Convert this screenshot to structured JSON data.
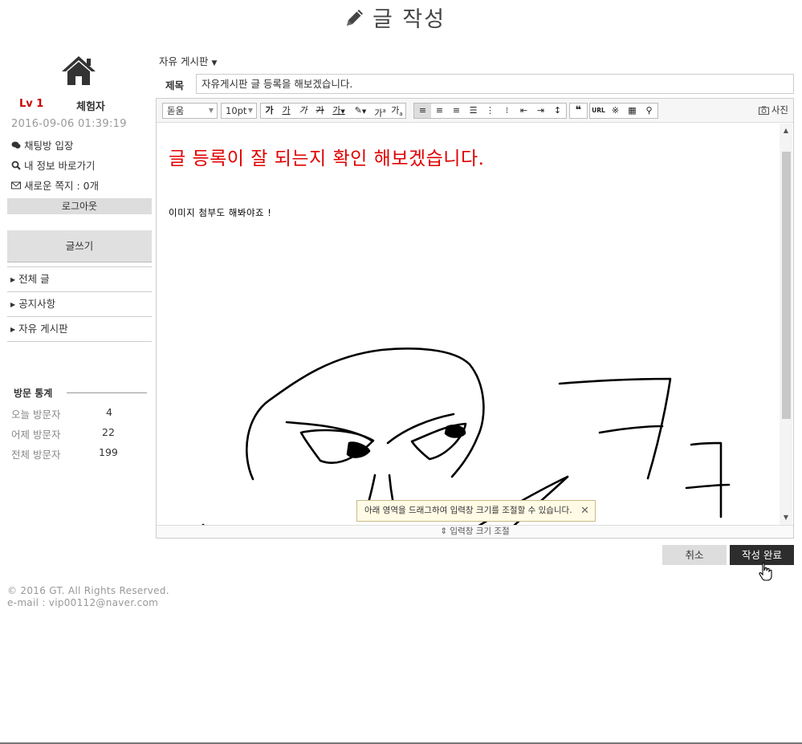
{
  "header": {
    "title": "글 작성",
    "icon": "pencil-icon"
  },
  "sidebar": {
    "home_icon": "home-icon",
    "level": "Lv 1",
    "role": "체험자",
    "login_time": "2016-09-06 01:39:19",
    "links": [
      {
        "icon": "chat-icon",
        "label": "채팅방 입장"
      },
      {
        "icon": "search-icon",
        "label": "내 정보 바로가기"
      },
      {
        "icon": "envelope-icon",
        "label": "새로운 쪽지 : 0개"
      }
    ],
    "logout_label": "로그아웃",
    "write_label": "글쓰기",
    "menu": [
      "전체 글",
      "공지사항",
      "자유 게시판"
    ],
    "stats": {
      "title": "방문 통계",
      "rows": [
        {
          "label": "오늘 방문자",
          "value": "4"
        },
        {
          "label": "어제 방문자",
          "value": "22"
        },
        {
          "label": "전체 방문자",
          "value": "199"
        }
      ]
    }
  },
  "form": {
    "board_select": "자유 게시판",
    "title_label": "제목",
    "title_value": "자유게시판 글 등록을 해보겠습니다."
  },
  "editor": {
    "font_family": "돋움",
    "font_size": "10pt",
    "toolbar_buttons": [
      "가",
      "가",
      "가",
      "가",
      "가",
      "가",
      "가",
      "가"
    ],
    "photo_label": "사진",
    "url_label": "URL",
    "content_heading": "글 등록이 잘 되는지 확인 해보겠습니다.",
    "content_text": "이미지 첨부도 해봐야죠 !",
    "resize_label": "입력창 크기 조절",
    "tooltip": "아래 영역을 드래그하여 입력창 크기를 조절할 수 있습니다.",
    "heading_color": "#e00000"
  },
  "actions": {
    "cancel_label": "취소",
    "submit_label": "작성 완료"
  },
  "footer": {
    "copyright": "© 2016 GT. All Rights Reserved.",
    "email": "e-mail : vip00112@naver.com"
  }
}
